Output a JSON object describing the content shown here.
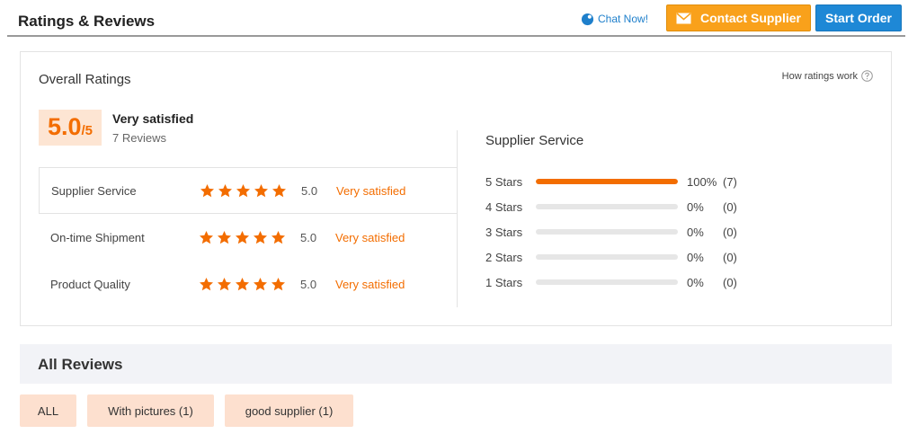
{
  "header": {
    "title": "Ratings & Reviews",
    "chat_now": "Chat Now!",
    "contact_supplier": "Contact Supplier",
    "start_order": "Start Order"
  },
  "overall": {
    "title": "Overall Ratings",
    "how_ratings": "How ratings work",
    "score": "5.0",
    "score_suffix": "/5",
    "satisfaction": "Very satisfied",
    "reviews": "7 Reviews"
  },
  "categories": [
    {
      "label": "Supplier Service",
      "stars": 5,
      "value": "5.0",
      "desc": "Very satisfied"
    },
    {
      "label": "On-time Shipment",
      "stars": 5,
      "value": "5.0",
      "desc": "Very satisfied"
    },
    {
      "label": "Product Quality",
      "stars": 5,
      "value": "5.0",
      "desc": "Very satisfied"
    }
  ],
  "service": {
    "title": "Supplier Service",
    "rows": [
      {
        "label": "5 Stars",
        "pct": "100%",
        "count": "(7)",
        "fill": 1.0
      },
      {
        "label": "4 Stars",
        "pct": "0%",
        "count": "(0)",
        "fill": 0
      },
      {
        "label": "3 Stars",
        "pct": "0%",
        "count": "(0)",
        "fill": 0
      },
      {
        "label": "2 Stars",
        "pct": "0%",
        "count": "(0)",
        "fill": 0
      },
      {
        "label": "1 Stars",
        "pct": "0%",
        "count": "(0)",
        "fill": 0
      }
    ]
  },
  "all_reviews": {
    "title": "All Reviews",
    "filters": [
      "ALL",
      "With pictures (1)",
      "good supplier (1)"
    ]
  },
  "colors": {
    "accent": "#f36d00",
    "contact_button": "#f9a11b",
    "start_button": "#1e88d6",
    "link": "#1e7fcb",
    "badge_bg": "#fde5d3",
    "chip_bg": "#fde0cf"
  }
}
